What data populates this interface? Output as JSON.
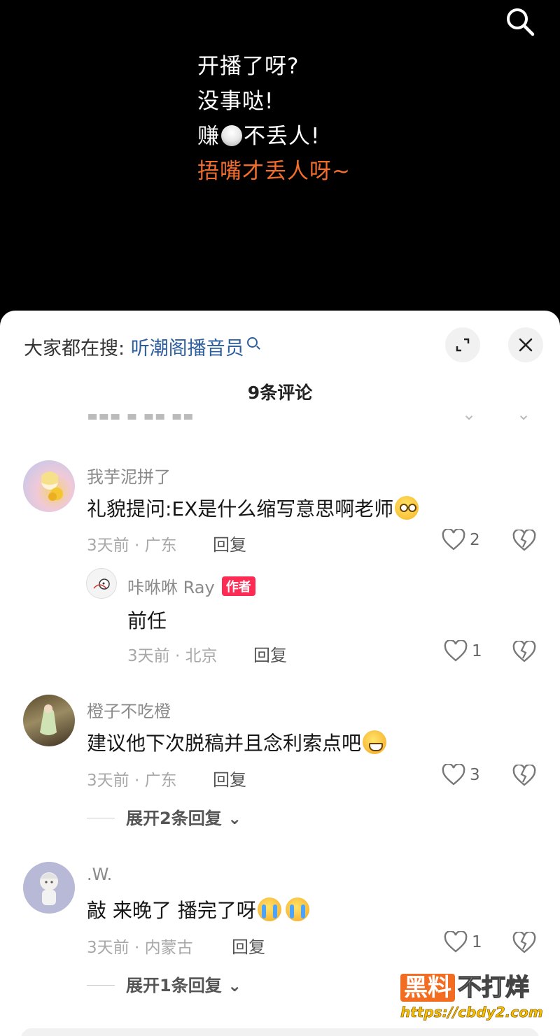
{
  "video": {
    "line1": "开播了呀?",
    "line2": "没事哒!",
    "line3_a": "赚",
    "line3_b": "不丢人!",
    "line4": "捂嘴才丢人呀~",
    "accent_color": "#f26d2c"
  },
  "sheet": {
    "hot_search_prefix": "大家都在搜: ",
    "hot_search_term": "听潮阁播音员",
    "comment_count": "9条评论"
  },
  "comments": [
    {
      "user": "我芋泥拼了",
      "text": "礼貌提问:EX是什么缩写意思啊老师",
      "time_loc": "3天前 · 广东",
      "reply_label": "回复",
      "likes": "2",
      "reply": {
        "user": "咔咻咻 Ray",
        "badge": "作者",
        "text": "前任",
        "time_loc": "3天前 · 北京",
        "reply_label": "回复",
        "likes": "1"
      }
    },
    {
      "user": "橙子不吃橙",
      "text": "建议他下次脱稿并且念利索点吧",
      "time_loc": "3天前 · 广东",
      "reply_label": "回复",
      "likes": "3",
      "more": "展开2条回复"
    },
    {
      "user": ".W.",
      "text": "敲 来晚了 播完了呀",
      "time_loc": "3天前 · 内蒙古",
      "reply_label": "回复",
      "likes": "1",
      "more": "展开1条回复"
    }
  ],
  "watermark": {
    "box": "黑料",
    "rest": "不打烊",
    "url": "https://cbdy2.com"
  }
}
